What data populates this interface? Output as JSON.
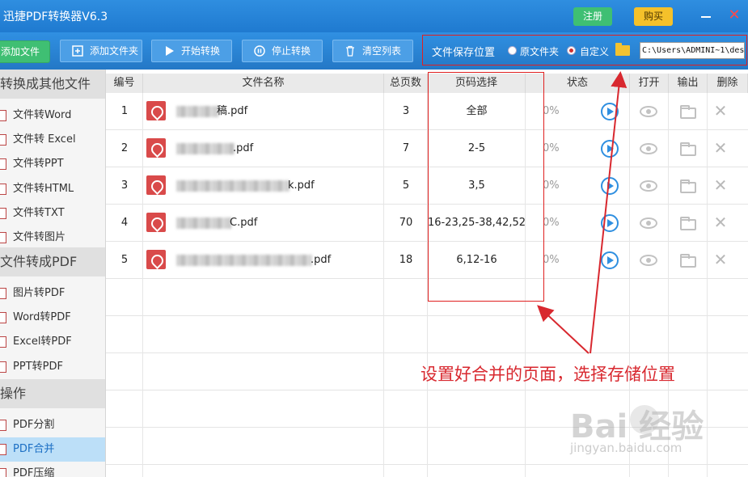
{
  "title_bar": {
    "app_title": "迅捷PDF转换器V6.3",
    "register_label": "注册",
    "buy_label": "购买"
  },
  "toolbar": {
    "add_file_label": "添加文件",
    "add_folder_label": "添加文件夹",
    "start_label": "开始转换",
    "stop_label": "停止转换",
    "clear_label": "清空列表",
    "save_location": {
      "label": "文件保存位置",
      "option_original": "原文件夹",
      "option_custom": "自定义",
      "selected": "自定义",
      "path": "C:\\Users\\ADMINI~1\\des"
    }
  },
  "sidebar": {
    "sections": [
      {
        "title": "转换成其他文件",
        "items": [
          "文件转Word",
          "文件转 Excel",
          "文件转PPT",
          "文件转HTML",
          "文件转TXT",
          "文件转图片"
        ]
      },
      {
        "title": "文件转成PDF",
        "items": [
          "图片转PDF",
          "Word转PDF",
          "Excel转PDF",
          "PPT转PDF"
        ]
      },
      {
        "title": "操作",
        "items": [
          "PDF分割",
          "PDF合并",
          "PDF压缩"
        ]
      }
    ],
    "active_item": "PDF合并"
  },
  "table": {
    "columns": [
      "编号",
      "文件名称",
      "总页数",
      "页码选择",
      "状态",
      "打开",
      "输出",
      "删除"
    ],
    "rows": [
      {
        "index": "1",
        "name_suffix": "稿.pdf",
        "pages": "3",
        "page_selection": "全部",
        "progress": "0%"
      },
      {
        "index": "2",
        "name_suffix": ".pdf",
        "pages": "7",
        "page_selection": "2-5",
        "progress": "0%"
      },
      {
        "index": "3",
        "name_suffix": "k.pdf",
        "pages": "5",
        "page_selection": "3,5",
        "progress": "0%"
      },
      {
        "index": "4",
        "name_suffix": "C.pdf",
        "pages": "70",
        "page_selection": "16-23,25-38,42,52",
        "progress": "0%"
      },
      {
        "index": "5",
        "name_suffix": ".pdf",
        "pages": "18",
        "page_selection": "6,12-16",
        "progress": "0%"
      }
    ]
  },
  "annotation": "设置好合并的页面，选择存储位置",
  "watermark": {
    "logo": "Bai  经验",
    "url": "jingyan.baidu.com"
  },
  "colors": {
    "title_bar": "#1f7ad0",
    "accent_green": "#3fbf73",
    "accent_yellow": "#f5c12a",
    "highlight_red": "#e02020",
    "annotation_red": "#d8282f",
    "active_sidebar": "#bcdff8"
  }
}
